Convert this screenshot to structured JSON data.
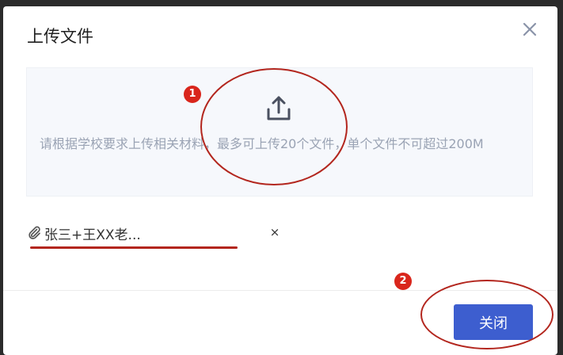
{
  "dialog": {
    "title": "上传文件",
    "close_icon": "close-icon"
  },
  "upload": {
    "icon": "upload-icon",
    "hint": "请根据学校要求上传相关材料，最多可上传20个文件，单个文件不可超过200M"
  },
  "file_list": [
    {
      "name": "张三+王XX老...",
      "icon": "paperclip-icon",
      "remove_label": "×"
    }
  ],
  "footer": {
    "close_label": "关闭",
    "button_color": "#3d5ecf"
  },
  "annotations": {
    "color": "#b3261e",
    "badges": [
      "1",
      "2"
    ]
  }
}
